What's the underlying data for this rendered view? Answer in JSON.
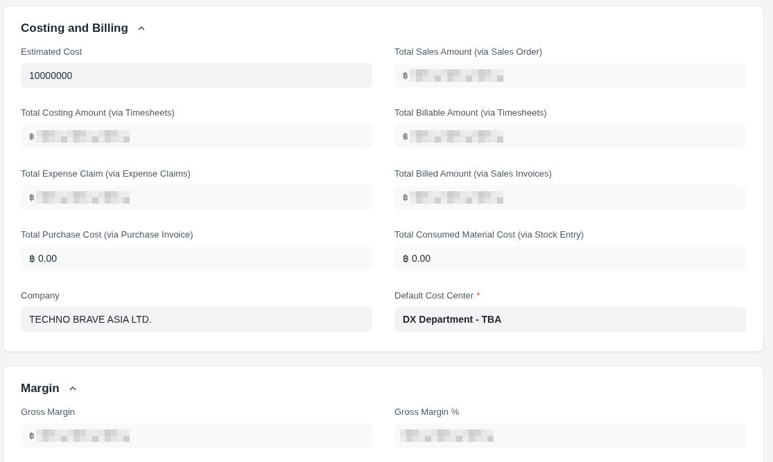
{
  "sections": [
    {
      "title": "Costing and Billing",
      "expanded": true,
      "columns": [
        [
          {
            "label": "Estimated Cost",
            "value": "10000000",
            "read_only": false,
            "kind": "number"
          },
          {
            "label": "Total Costing Amount (via Timesheets)",
            "value": "฿",
            "read_only": true,
            "redacted": true,
            "kind": "number"
          },
          {
            "label": "Total Expense Claim (via Expense Claims)",
            "value": "฿",
            "read_only": true,
            "redacted": true,
            "kind": "number"
          },
          {
            "label": "Total Purchase Cost (via Purchase Invoice)",
            "value": "฿ 0.00",
            "read_only": true,
            "kind": "number"
          },
          {
            "label": "Company",
            "value": "TECHNO BRAVE ASIA LTD.",
            "read_only": false,
            "kind": "text"
          }
        ],
        [
          {
            "label": "Total Sales Amount (via Sales Order)",
            "value": "฿",
            "read_only": true,
            "redacted": true,
            "kind": "number"
          },
          {
            "label": "Total Billable Amount (via Timesheets)",
            "value": "฿",
            "read_only": true,
            "redacted": true,
            "kind": "number"
          },
          {
            "label": "Total Billed Amount (via Sales Invoices)",
            "value": "฿",
            "read_only": true,
            "redacted": true,
            "kind": "number"
          },
          {
            "label": "Total Consumed Material Cost (via Stock Entry)",
            "value": "฿ 0.00",
            "read_only": true,
            "kind": "number"
          },
          {
            "label": "Default Cost Center",
            "required_mark": "*",
            "value": "DX Department - TBA",
            "read_only": false,
            "kind": "link"
          }
        ]
      ]
    },
    {
      "title": "Margin",
      "expanded": true,
      "columns": [
        [
          {
            "label": "Gross Margin",
            "value": "฿",
            "read_only": true,
            "redacted": true,
            "kind": "number"
          }
        ],
        [
          {
            "label": "Gross Margin %",
            "read_only": true,
            "redacted": true,
            "kind": "number"
          }
        ]
      ]
    }
  ]
}
